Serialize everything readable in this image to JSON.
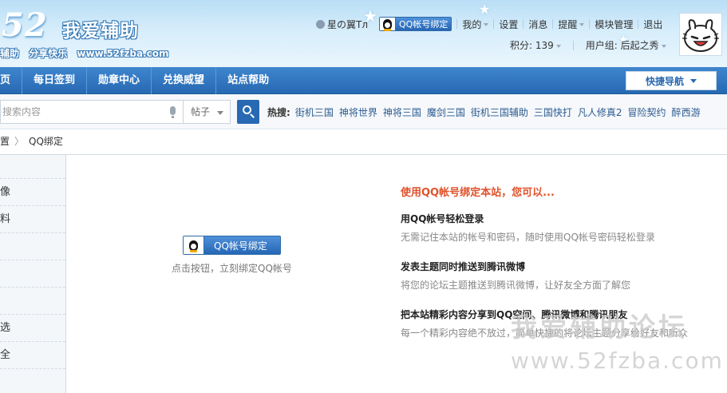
{
  "header": {
    "logo_number": "52",
    "logo_title": "我爱辅助",
    "logo_slogan_1": "辅助",
    "logo_slogan_2": "分享快乐",
    "logo_url": "www.52fzba.com",
    "username": "星の翼Tл",
    "qq_bind_label": "QQ帐号绑定",
    "menu": [
      "我的",
      "设置",
      "消息",
      "提醒",
      "模块管理",
      "退出"
    ],
    "points_label": "积分: 139",
    "usergroup_label": "用户组: 后起之秀"
  },
  "nav": {
    "items": [
      "页",
      "每日签到",
      "勋章中心",
      "兑换威望",
      "站点帮助"
    ],
    "quicknav_label": "快捷导航"
  },
  "search": {
    "placeholder": "搜索内容",
    "select_value": "帖子",
    "hot_label": "热搜:",
    "hot_items": [
      "街机三国",
      "神将世界",
      "神将三国",
      "魔剑三国",
      "街机三国辅助",
      "三国快打",
      "凡人修真2",
      "冒险契约",
      "醉西游"
    ]
  },
  "breadcrumb": {
    "parent": "置",
    "current": "QQ绑定"
  },
  "sidebar": {
    "items": [
      "",
      "像",
      "料",
      "",
      "",
      "",
      "选",
      "全"
    ]
  },
  "bind": {
    "button_label": "QQ帐号绑定",
    "hint": "点击按钮，立刻绑定QQ帐号"
  },
  "info": {
    "heading": "使用QQ帐号绑定本站，您可以...",
    "features": [
      {
        "title": "用QQ帐号轻松登录",
        "desc": "无需记住本站的帐号和密码，随时使用QQ帐号密码轻松登录"
      },
      {
        "title": "发表主题同时推送到腾讯微博",
        "desc": "将您的论坛主题推送到腾讯微博，让好友全方面了解您"
      },
      {
        "title": "把本站精彩内容分享到QQ空间、腾讯微博和腾讯朋友",
        "desc": "每一个精彩内容绝不放过，简单快捷的将论坛主题分享给好友和听众"
      }
    ]
  },
  "watermark": {
    "line1": "我爱辅助论坛",
    "line2": "www.52fzba.com"
  },
  "colors": {
    "nav_blue": "#2769b2",
    "accent_orange": "#e0522b"
  }
}
